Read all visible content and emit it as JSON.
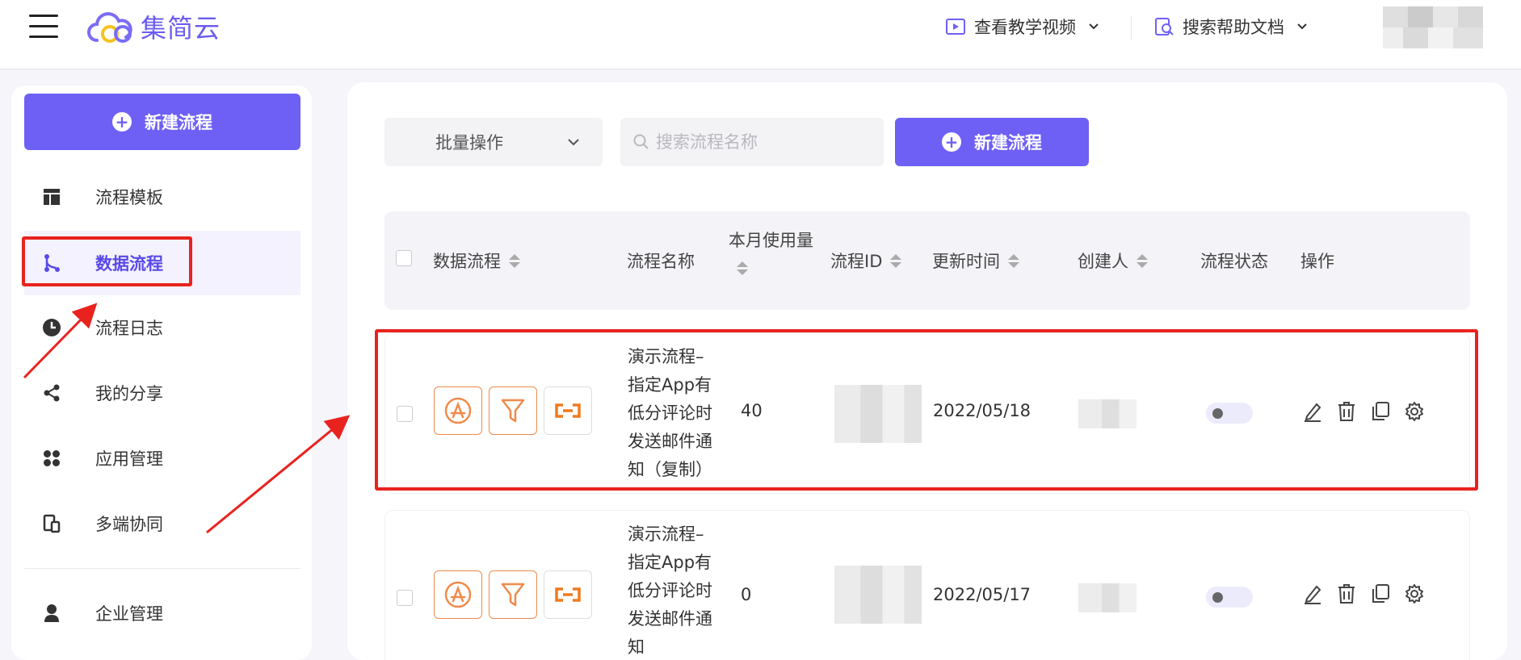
{
  "header": {
    "logo_text": "集简云",
    "video_link": "查看教学视频",
    "docs_link": "搜索帮助文档"
  },
  "sidebar": {
    "new_button": "新建流程",
    "items": [
      {
        "label": "流程模板",
        "icon": "template-icon"
      },
      {
        "label": "数据流程",
        "icon": "flow-branch-icon"
      },
      {
        "label": "流程日志",
        "icon": "clock-icon"
      },
      {
        "label": "我的分享",
        "icon": "share-icon"
      },
      {
        "label": "应用管理",
        "icon": "apps-grid-icon"
      },
      {
        "label": "多端协同",
        "icon": "devices-icon"
      },
      {
        "label": "企业管理",
        "icon": "user-icon"
      }
    ],
    "active_item": "数据流程"
  },
  "toolbar": {
    "batch_label": "批量操作",
    "search_placeholder": "搜索流程名称",
    "new_button": "新建流程"
  },
  "table": {
    "columns": [
      "数据流程",
      "流程名称",
      "本月使用量",
      "流程ID",
      "更新时间",
      "创建人",
      "流程状态",
      "操作"
    ],
    "rows": [
      {
        "name_lines": [
          "演示流程–",
          "指定App有",
          "低分评论时",
          "发送邮件通",
          "知（复制）"
        ],
        "usage": "40",
        "updated": "2022/05/18",
        "enabled": false
      },
      {
        "name_lines": [
          "演示流程–",
          "指定App有",
          "低分评论时",
          "发送邮件通",
          "知"
        ],
        "usage": "0",
        "updated": "2022/05/17",
        "enabled": false
      }
    ]
  },
  "colors": {
    "accent": "#6e60f5",
    "app_icon": "#f08a4b",
    "highlight": "#e8231f"
  }
}
